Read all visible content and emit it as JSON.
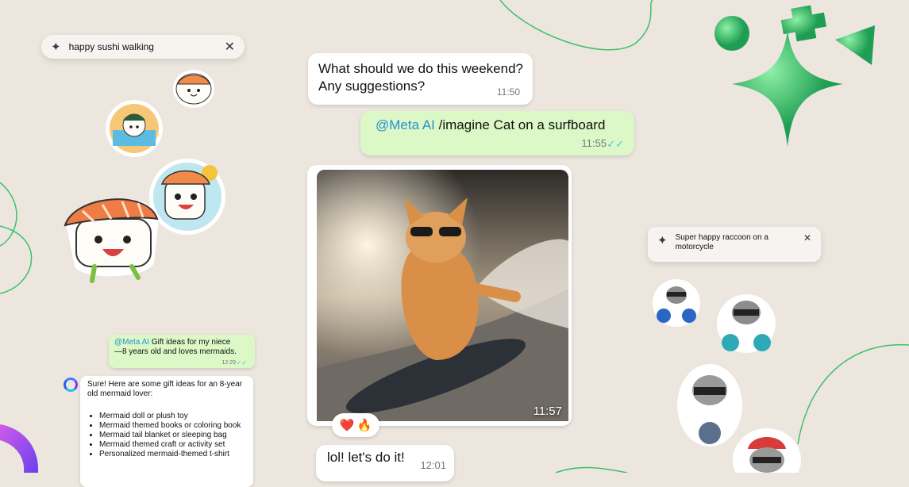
{
  "search_left": {
    "icon": "sparkle-icon",
    "text": "happy sushi walking",
    "close_icon": "close-icon"
  },
  "search_right": {
    "icon": "sparkle-icon",
    "text": "Super happy raccoon on a motorcycle",
    "close_icon": "close-icon"
  },
  "chat": {
    "msg1": {
      "text_line1": "What should we do this weekend?",
      "text_line2": "Any suggestions?",
      "time": "11:50"
    },
    "msg2": {
      "mention": "@Meta AI",
      "text": " /imagine Cat on a surfboard",
      "time": "11:55",
      "status_icon": "double-check-icon"
    },
    "image_msg": {
      "time": "11:57",
      "image_icon": "cat-surfing-photo",
      "reactions": [
        "❤️",
        "🔥"
      ]
    },
    "msg3": {
      "text": "lol! let's do it!",
      "time": "12:01"
    }
  },
  "mini_chat": {
    "out": {
      "mention": "@Meta AI",
      "text_line1": " Gift ideas for my niece",
      "text_line2": "—8 years old and loves mermaids.",
      "time": "12:29"
    },
    "in": {
      "intro_line1": "Sure! Here are some gift ideas for an 8-year",
      "intro_line2": "old mermaid lover:",
      "items": [
        "Mermaid doll or plush toy",
        "Mermaid themed books or coloring book",
        "Mermaid tail blanket or sleeping bag",
        "Mermaid themed craft or activity set",
        "Personalized mermaid-themed t-shirt"
      ]
    }
  },
  "colors": {
    "background": "#ece6df",
    "outgoing": "#dcf8c6",
    "incoming": "#ffffff",
    "accent_green": "#25d366",
    "mention_blue": "#2a8fd7",
    "read_blue": "#53bdeb"
  }
}
